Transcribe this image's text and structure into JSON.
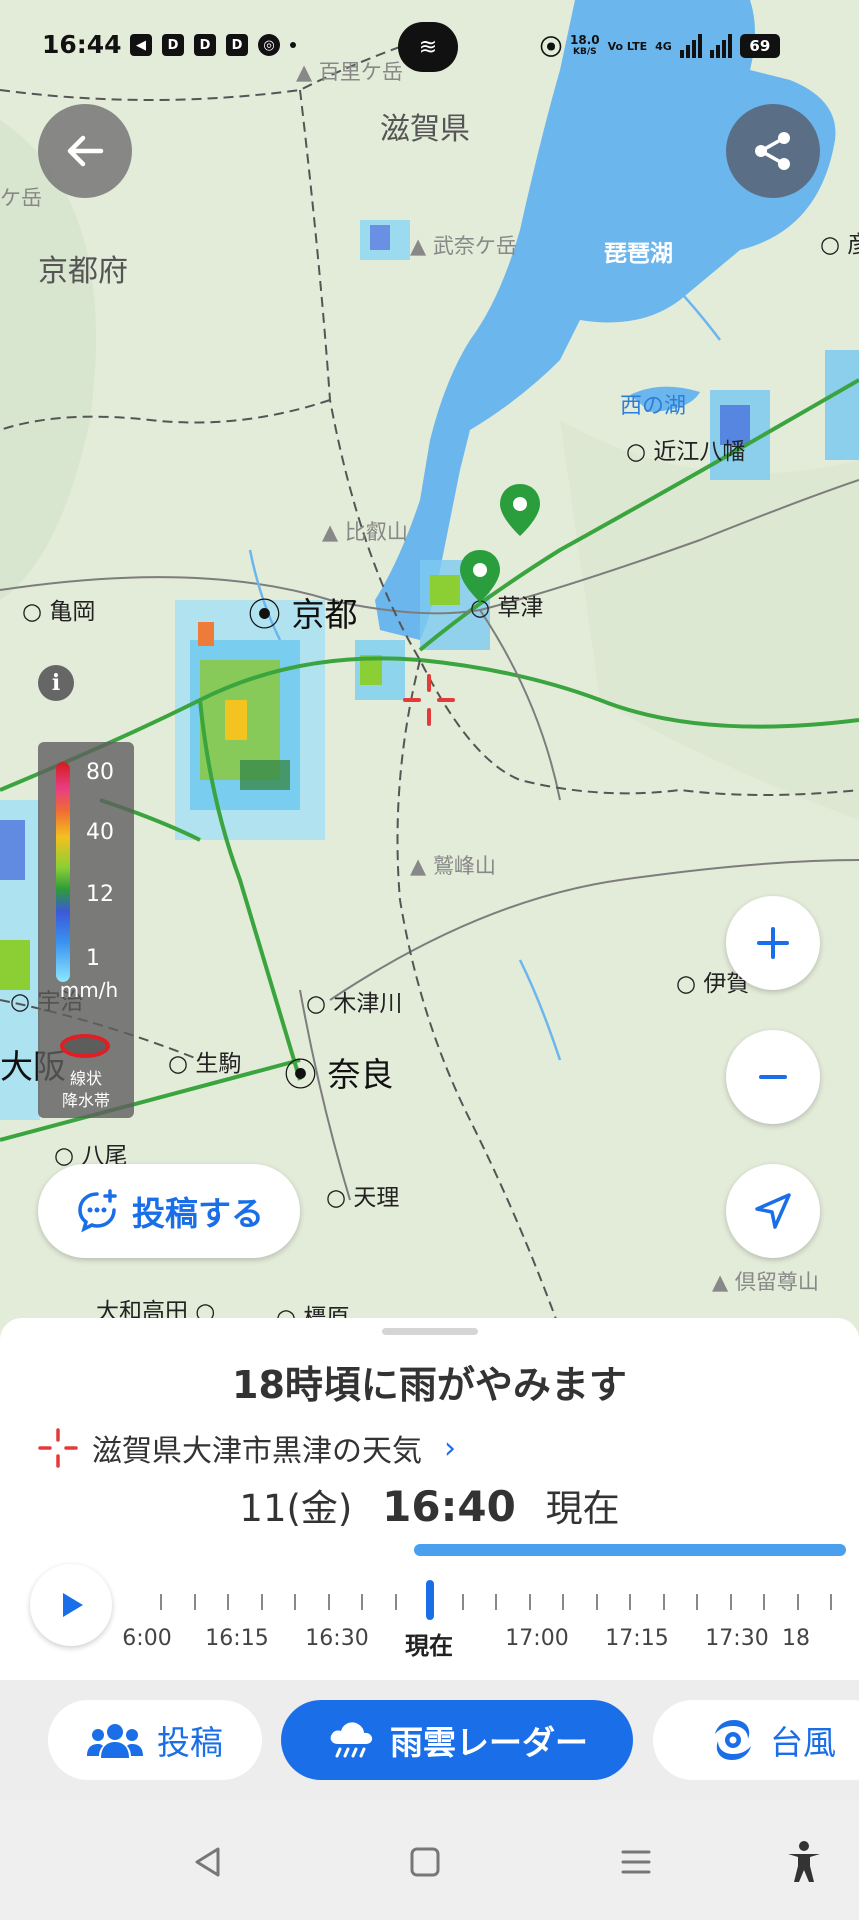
{
  "status_bar": {
    "time": "16:44",
    "network_speed": "18.0",
    "network_unit": "KB/S",
    "volte": "Vo LTE",
    "network_type": "4G",
    "battery": "69"
  },
  "map": {
    "prefectures": [
      "滋賀県",
      "京都府"
    ],
    "lakes": [
      "琵琶湖",
      "西の湖"
    ],
    "cities": {
      "kyoto": "京都",
      "nara": "奈良",
      "osaka": "大阪",
      "kusatsu": "草津",
      "omihachiman": "近江八幡",
      "kameoka": "亀岡",
      "kizugawa": "木津川",
      "ikoma": "生駒",
      "yao": "八尾",
      "tenri": "天理",
      "yamatotakada": "大和高田",
      "kashihara": "橿原",
      "uji": "宇治",
      "iga": "伊賀"
    },
    "mountains": [
      "百里ケ岳",
      "武奈ケ岳",
      "比叡山",
      "鷲峰山",
      "倶留尊山"
    ],
    "edge_labels": [
      "ケ岳",
      "彦"
    ],
    "legend": {
      "values": [
        "80",
        "40",
        "12",
        "1"
      ],
      "unit": "mm/h",
      "linear_rain_band_label": "線状\n降水帯"
    },
    "post_button_label": "投稿する",
    "controls": [
      "zoom-in",
      "zoom-out",
      "current-location"
    ]
  },
  "sheet": {
    "headline": "18時頃に雨がやみます",
    "location": "滋賀県大津市黒津の天気",
    "date": "11(金)",
    "time": "16:40",
    "now_suffix": "現在",
    "timeline_labels": [
      "6:00",
      "16:15",
      "16:30",
      "現在",
      "17:00",
      "17:15",
      "17:30",
      "18"
    ]
  },
  "tabs": [
    {
      "label": "投稿"
    },
    {
      "label": "雨雲レーダー"
    },
    {
      "label": "台風"
    }
  ],
  "colors": {
    "accent": "#1a6fe8",
    "lake": "#6cb6ee",
    "pin": "#2a9d3c"
  }
}
